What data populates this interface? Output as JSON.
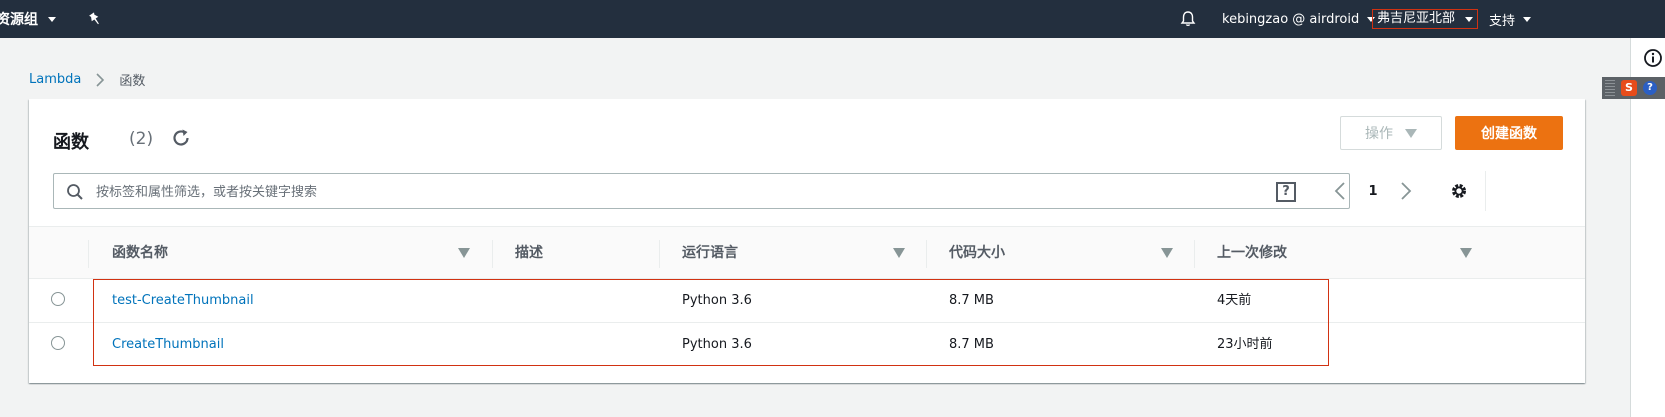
{
  "topbar": {
    "resource_groups": "资源组",
    "account": "kebingzao @ airdroid",
    "region": "弗吉尼亚北部",
    "support": "支持"
  },
  "breadcrumb": {
    "root": "Lambda",
    "current": "函数"
  },
  "card": {
    "title": "函数",
    "count": "(2)",
    "actions_label": "操作",
    "create_label": "创建函数",
    "search_placeholder": "按标签和属性筛选，或者按关键字搜索",
    "page_number": "1"
  },
  "table": {
    "columns": [
      "函数名称",
      "描述",
      "运行语言",
      "代码大小",
      "上一次修改"
    ],
    "rows": [
      {
        "name": "test-CreateThumbnail",
        "description": "",
        "runtime": "Python 3.6",
        "code_size": "8.7 MB",
        "last_modified": "4天前"
      },
      {
        "name": "CreateThumbnail",
        "description": "",
        "runtime": "Python 3.6",
        "code_size": "8.7 MB",
        "last_modified": "23小时前"
      }
    ]
  },
  "colors": {
    "accent": "#ec7211",
    "link": "#0073bb",
    "topbar": "#232f3e",
    "highlight": "#d13212"
  },
  "icons": [
    "caret-down-icon",
    "pin-icon",
    "bell-icon",
    "info-icon",
    "refresh-icon",
    "search-icon",
    "help-icon",
    "chevron-left-icon",
    "chevron-right-icon",
    "gear-icon",
    "sort-icon",
    "ime-icon"
  ]
}
